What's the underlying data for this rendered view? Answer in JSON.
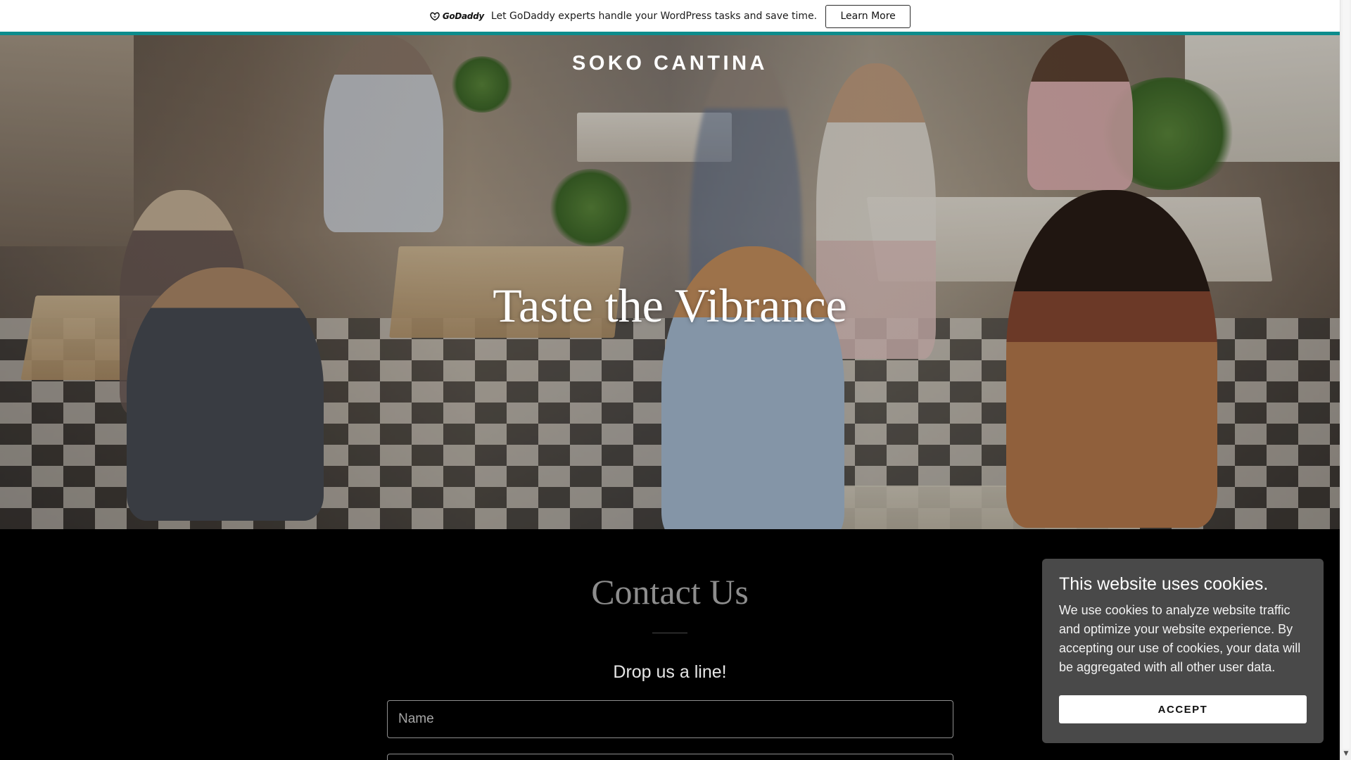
{
  "promo": {
    "logo_text": "GoDaddy",
    "message": "Let GoDaddy experts handle your WordPress tasks and save time.",
    "button_label": "Learn More",
    "accent_color": "#0c8c8c"
  },
  "hero": {
    "brand": "SOKO CANTINA",
    "title": "Taste the Vibrance"
  },
  "contact": {
    "title": "Contact Us",
    "subtitle": "Drop us a line!",
    "name_placeholder": "Name",
    "email_placeholder": ""
  },
  "cookie_banner": {
    "title": "This website uses cookies.",
    "body": "We use cookies to analyze website traffic and optimize your website experience. By accepting our use of cookies, your data will be aggregated with all other user data.",
    "accept_label": "ACCEPT"
  },
  "icons": {
    "logo": "godaddy-logo-icon",
    "scroll_down": "chevron-down-icon"
  }
}
